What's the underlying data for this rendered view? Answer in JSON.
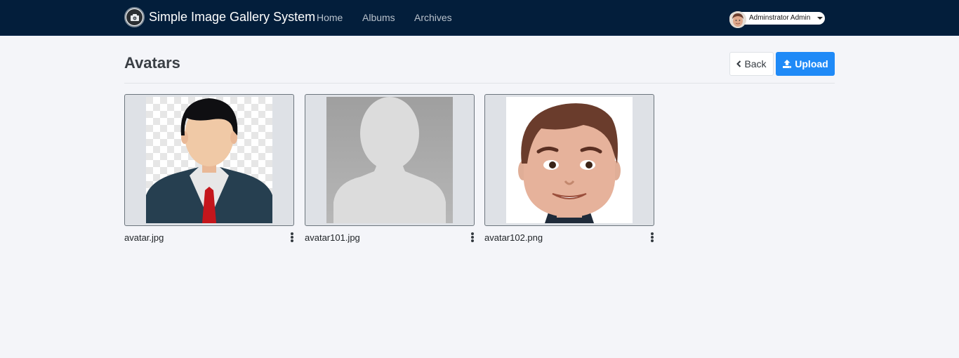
{
  "navbar": {
    "brand_title": "Simple Image Gallery System",
    "links": [
      {
        "label": "Home"
      },
      {
        "label": "Albums"
      },
      {
        "label": "Archives"
      }
    ],
    "user_name": "Adminstrator Admin"
  },
  "header": {
    "title": "Avatars",
    "back_label": "Back",
    "upload_label": "Upload"
  },
  "gallery": {
    "items": [
      {
        "file_name": "avatar.jpg",
        "image": "business-man-avatar"
      },
      {
        "file_name": "avatar101.jpg",
        "image": "default-silhouette-avatar"
      },
      {
        "file_name": "avatar102.png",
        "image": "cartoon-face-avatar"
      }
    ]
  },
  "colors": {
    "navbar_bg": "#031e3b",
    "page_bg": "#f4f5f9",
    "primary": "#1f8af7"
  },
  "icons": {
    "brand": "camera-icon",
    "back": "chevron-left-icon",
    "upload": "upload-icon",
    "menu": "kebab-menu-icon",
    "user_dropdown": "caret-down-icon"
  }
}
